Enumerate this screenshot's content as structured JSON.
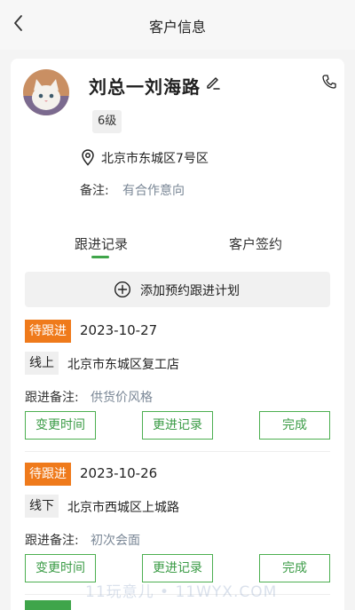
{
  "nav": {
    "title": "客户信息"
  },
  "customer": {
    "name": "刘总一刘海路",
    "level": "6级",
    "address": "北京市东城区7号区",
    "note_label": "备注:",
    "note_value": "有合作意向"
  },
  "tabs": [
    {
      "label": "跟进记录",
      "active": true
    },
    {
      "label": "客户签约",
      "active": false
    }
  ],
  "add_plan": {
    "label": "添加预约跟进计划"
  },
  "records": [
    {
      "status": "待跟进",
      "date": "2023-10-27",
      "mode": "线上",
      "address": "北京市东城区复工店",
      "note_label": "跟进备注:",
      "note_value": "供货价风格",
      "buttons": {
        "change_time": "变更时间",
        "update_record": "更进记录",
        "complete": "完成"
      }
    },
    {
      "status": "待跟进",
      "date": "2023-10-26",
      "mode": "线下",
      "address": "北京市西城区上城路",
      "note_label": "跟进备注:",
      "note_value": "初次会面",
      "buttons": {
        "change_time": "变更时间",
        "update_record": "更进记录",
        "complete": "完成"
      }
    }
  ],
  "watermark": "11玩意儿 • 11WYX.COM",
  "colors": {
    "accent_green": "#3fa54a",
    "status_orange": "#ef7a1b",
    "note_gray": "#7a8796"
  },
  "icons": [
    "back-arrow-icon",
    "edit-pencil-icon",
    "phone-icon",
    "location-pin-icon",
    "plus-circle-icon"
  ]
}
